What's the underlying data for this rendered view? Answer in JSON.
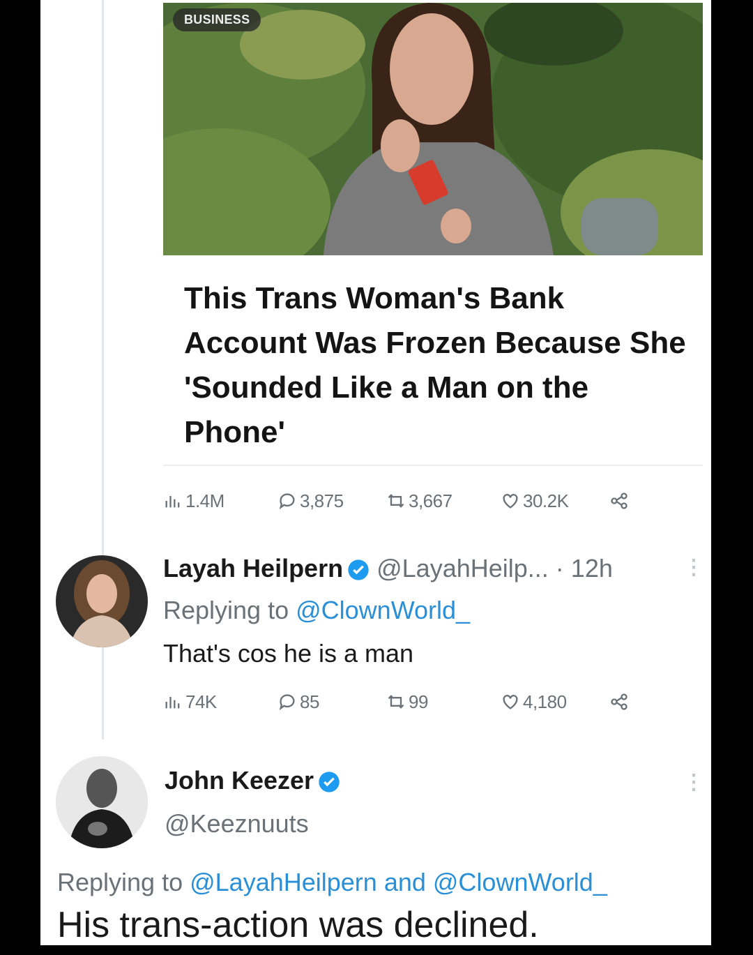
{
  "article": {
    "category": "BUSINESS",
    "title": "This Trans Woman's Bank Account Was Frozen Because She 'Sounded Like a Man on the Phone'"
  },
  "article_metrics": {
    "views": "1.4M",
    "replies": "3,875",
    "retweets": "3,667",
    "likes": "30.2K"
  },
  "reply1": {
    "name": "Layah Heilpern",
    "handle": "@LayahHeilp...",
    "time_sep": " · ",
    "time": "12h",
    "replying_prefix": "Replying to ",
    "replying_to": "@ClownWorld_",
    "text": "That's cos he is a man",
    "metrics": {
      "views": "74K",
      "replies": "85",
      "retweets": "99",
      "likes": "4,180"
    }
  },
  "reply2": {
    "name": "John Keezer",
    "handle": "@Keeznuuts",
    "replying_prefix": "Replying to ",
    "replying_to_1": "@LayahHeilpern",
    "replying_and": " and ",
    "replying_to_2": "@ClownWorld_",
    "text": "His trans-action was declined."
  },
  "colors": {
    "link": "#2a8fd6",
    "verified": "#1d9bf0",
    "muted": "#6a7278"
  },
  "icons": [
    "views-icon",
    "reply-icon",
    "retweet-icon",
    "like-icon",
    "share-icon",
    "verified-icon",
    "more-icon"
  ]
}
